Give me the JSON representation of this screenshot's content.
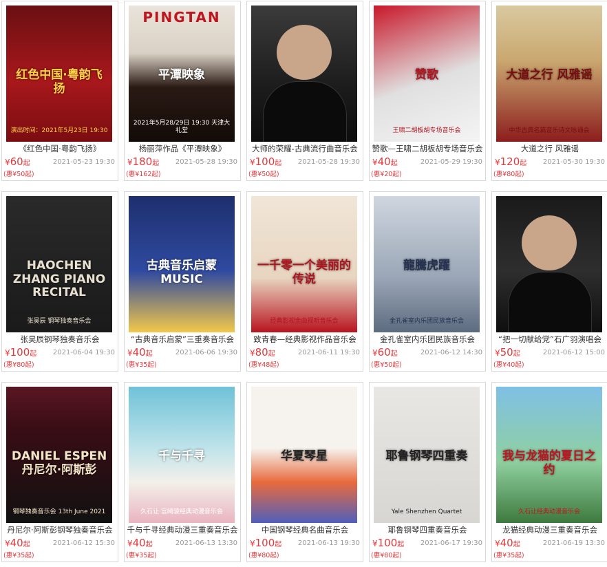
{
  "currency": "¥",
  "qi_suffix": "起",
  "events": [
    {
      "title": "《红色中国·粤韵飞扬》",
      "price": "60",
      "date": "2021-05-23 19:30",
      "member": "(惠¥50起)",
      "poster": {
        "bg": "linear-gradient(180deg,#6b0f12 0%,#a8181c 55%,#7a0d10 100%)",
        "text": "红色中国·粤韵飞扬",
        "sub": "演出时间：2021年5月23日 19:30",
        "color": "#ffd24a"
      }
    },
    {
      "title": "杨丽萍作品《平潭映象》",
      "price": "180",
      "date": "2021-05-28 19:30",
      "member": "(惠¥162起)",
      "poster": {
        "bg": "linear-gradient(180deg,#e9e4dc 0%,#d9d1c4 35%,#2a1a14 60%,#120b08 100%)",
        "text": "平潭映象",
        "sub": "2021年5月28/29日 19:30 天津大礼堂",
        "color": "#ffffff",
        "banner": "PINGTAN"
      }
    },
    {
      "title": "大师的荣耀-古典流行曲音乐会",
      "price": "100",
      "date": "2021-05-28 19:30",
      "member": "(惠¥50起)",
      "poster": {
        "bg": "linear-gradient(180deg,#3b3b3b 0%,#1c1c1c 60%,#0d0d0d 100%)",
        "text": "",
        "sub": "",
        "color": "#ffffff"
      }
    },
    {
      "title": "赞歌—王啸二胡板胡专场音乐会",
      "price": "40",
      "date": "2021-05-29 19:30",
      "member": "(惠¥20起)",
      "poster": {
        "bg": "linear-gradient(160deg,#c8182a 0%,#e0e0e0 55%,#f4f4f4 100%)",
        "text": "赞歌",
        "sub": "王啸二胡板胡专场音乐会",
        "color": "#b0141f"
      }
    },
    {
      "title": "大道之行 风雅谣",
      "price": "120",
      "date": "2021-05-30 19:30",
      "member": "(惠¥80起)",
      "poster": {
        "bg": "linear-gradient(180deg,#d9c9a0 0%,#caa870 40%,#8c1d1d 100%)",
        "text": "大道之行 风雅谣",
        "sub": "中华古典名篇音乐诗文咏诵会",
        "color": "#7a0d0d"
      }
    },
    {
      "title": "张昊辰钢琴独奏音乐会",
      "price": "100",
      "date": "2021-06-04 19:30",
      "member": "(惠¥80起)",
      "poster": {
        "bg": "linear-gradient(180deg,#2a2a2a 0%,#1a1a1a 100%)",
        "text": "HAOCHEN ZHANG PIANO RECITAL",
        "sub": "张昊辰 钢琴独奏音乐会",
        "color": "#e8e0d0"
      }
    },
    {
      "title": "“古典音乐启蒙”三重奏音乐会",
      "price": "40",
      "date": "2021-06-06 19:30",
      "member": "(惠¥35起)",
      "poster": {
        "bg": "linear-gradient(180deg,#1e2f6e 0%,#2f4aa0 55%,#f2c84a 100%)",
        "text": "古典音乐启蒙 MUSIC",
        "sub": "",
        "color": "#ffffff"
      }
    },
    {
      "title": "致青春—经典影视作品音乐会",
      "price": "80",
      "date": "2021-06-11 19:30",
      "member": "(惠¥48起)",
      "poster": {
        "bg": "linear-gradient(180deg,#f0e6d8 0%,#e8d5c0 60%,#b8141f 100%)",
        "text": "一千零一个美丽的传说",
        "sub": "经典影视金曲视听音乐会",
        "color": "#b0141f"
      }
    },
    {
      "title": "金孔雀室内乐团民族音乐会",
      "price": "60",
      "date": "2021-06-12 14:30",
      "member": "(惠¥50起)",
      "poster": {
        "bg": "linear-gradient(180deg,#cfd6df 0%,#9aa6b6 60%,#5d6b80 100%)",
        "text": "龍騰虎躍",
        "sub": "金孔雀室内乐团民族音乐会",
        "color": "#243150"
      }
    },
    {
      "title": "“把一切献给党”石广羽演唱会",
      "price": "50",
      "date": "2021-06-12 15:00",
      "member": "(惠¥40起)",
      "poster": {
        "bg": "linear-gradient(180deg,#1a1a1a 0%,#2e2e2e 55%,#0e0e0e 100%)",
        "text": "",
        "sub": "",
        "color": "#ffffff"
      }
    },
    {
      "title": "丹尼尔·阿斯彭钢琴独奏音乐会",
      "price": "40",
      "date": "2021-06-12 15:30",
      "member": "(惠¥35起)",
      "poster": {
        "bg": "linear-gradient(180deg,#5a1622 0%,#3a0d15 30%,#111111 100%)",
        "text": "DANIEL ESPEN 丹尼尔·阿斯彭",
        "sub": "钢琴独奏音乐会 13th June 2021",
        "color": "#f3e6c8"
      }
    },
    {
      "title": "千与千寻经典动漫三重奏音乐会",
      "price": "40",
      "date": "2021-06-13 13:30",
      "member": "(惠¥35起)",
      "poster": {
        "bg": "linear-gradient(180deg,#6fc2d8 0%,#bfe3ea 45%,#f3f0ea 70%,#e9b4c0 100%)",
        "text": "千与千寻",
        "sub": "久石让·宫崎骏经典动漫音乐会",
        "color": "#ffffff"
      }
    },
    {
      "title": "中国钢琴经典名曲音乐会",
      "price": "100",
      "date": "2021-06-13 19:30",
      "member": "(惠¥80起)",
      "poster": {
        "bg": "linear-gradient(180deg,#f6f3ee 0%,#f6f3ee 45%,#e96a3c 70%,#4f5fbd 100%)",
        "text": "华夏琴星",
        "sub": "",
        "color": "#222222"
      }
    },
    {
      "title": "耶鲁钢琴四重奏音乐会",
      "price": "100",
      "date": "2021-06-17 19:30",
      "member": "(惠¥80起)",
      "poster": {
        "bg": "linear-gradient(180deg,#e9e7e4 0%,#d8d6d2 100%)",
        "text": "耶鲁钢琴四重奏",
        "sub": "Yale Shenzhen Quartet",
        "color": "#222222"
      }
    },
    {
      "title": "龙猫经典动漫三重奏音乐会",
      "price": "40",
      "date": "2021-06-19 13:30",
      "member": "(惠¥35起)",
      "poster": {
        "bg": "linear-gradient(180deg,#7fc0e6 0%,#8fd0a0 55%,#3e7a3e 100%)",
        "text": "我与龙猫的夏日之约",
        "sub": "久石让经典动漫音乐会",
        "color": "#c0141f"
      }
    }
  ]
}
